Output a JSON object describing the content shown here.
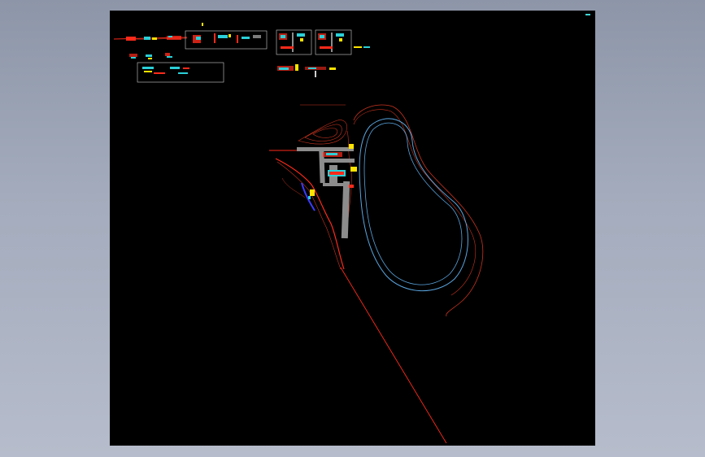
{
  "drawing": {
    "background": "#000000",
    "colors": {
      "road": "#ff2a1a",
      "contour": "#c8341f",
      "water": "#5aa6e0",
      "building": "#8c8c8c",
      "accent_cyan": "#2ad0d8",
      "accent_yellow": "#ffe400",
      "accent_blue": "#3c3cff",
      "frame": "#cfcfcf"
    }
  },
  "viewport": {
    "background_gradient": [
      "#8d96a8",
      "#b6bccb"
    ]
  }
}
